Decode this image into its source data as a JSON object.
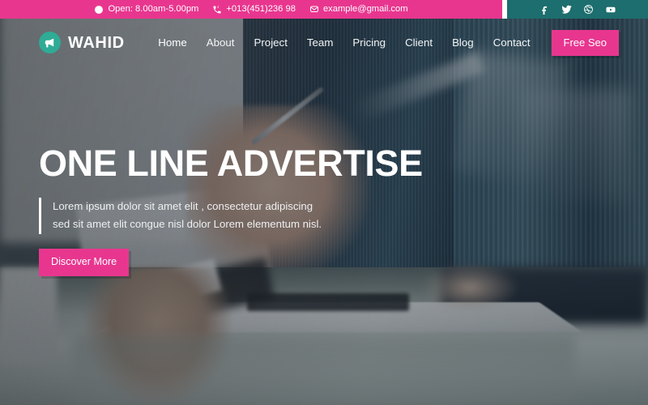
{
  "topbar": {
    "open_hours": "Open: 8.00am-5.00pm",
    "phone": "+013(451)236 98",
    "email": "example@gmail.com",
    "left_bg": "#e8368f",
    "right_bg": "#1d6e6e",
    "social": [
      {
        "name": "facebook",
        "label": "Facebook"
      },
      {
        "name": "twitter",
        "label": "Twitter"
      },
      {
        "name": "dribbble",
        "label": "Dribbble"
      },
      {
        "name": "youtube",
        "label": "YouTube"
      }
    ]
  },
  "nav": {
    "brand": "WAHID",
    "brand_icon": "megaphone-icon",
    "brand_badge_color": "#2fab96",
    "menu": [
      {
        "label": "Home",
        "active": true
      },
      {
        "label": "About",
        "active": false
      },
      {
        "label": "Project",
        "active": false
      },
      {
        "label": "Team",
        "active": false
      },
      {
        "label": "Pricing",
        "active": false
      },
      {
        "label": "Client",
        "active": false
      },
      {
        "label": "Blog",
        "active": false
      },
      {
        "label": "Contact",
        "active": false
      }
    ],
    "cta_label": "Free Seo",
    "cta_color": "#e8368f"
  },
  "hero": {
    "title": "ONE LINE ADVERTISE",
    "description": "Lorem ipsum dolor sit amet elit , consectetur adipiscing sed sit amet elit congue nisl dolor Lorem elementum nisl.",
    "cta_label": "Discover More",
    "cta_color": "#e8368f"
  }
}
